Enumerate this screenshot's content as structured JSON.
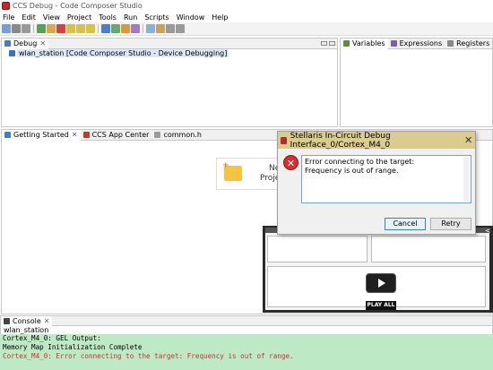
{
  "window": {
    "title": "CCS Debug - Code Composer Studio"
  },
  "menu": [
    "File",
    "Edit",
    "View",
    "Project",
    "Tools",
    "Run",
    "Scripts",
    "Window",
    "Help"
  ],
  "debug_view": {
    "tab_label": "Debug",
    "tree_item": "wlan_station [Code Composer Studio - Device Debugging]"
  },
  "right_views": {
    "tabs": [
      "Variables",
      "Expressions",
      "Registers"
    ]
  },
  "editor": {
    "tabs": [
      "Getting Started",
      "CCS App Center",
      "common.h"
    ],
    "card_partial_1": "Ne",
    "card_partial_2": "Proje"
  },
  "dialog": {
    "title": "Stellaris In-Circuit Debug Interface_0/Cortex_M4_0",
    "message_line1": "Error connecting to the target:",
    "message_line2": "Frequency is out of range.",
    "cancel_label": "Cancel",
    "retry_label": "Retry",
    "close_glyph": "✕",
    "error_glyph": "✕"
  },
  "video": {
    "play_all_label": "PLAY ALL"
  },
  "console": {
    "tab_label": "Console",
    "project": "wlan_station",
    "lines": [
      {
        "text": "Cortex_M4_0: GEL Output:",
        "color": "#000000"
      },
      {
        "text": "Memory Map Initialization Complete",
        "color": "#000000"
      },
      {
        "text": "Cortex_M4_0: Error connecting to the target: Frequency is out of range.",
        "color": "#d32f2f"
      }
    ]
  },
  "colors": {
    "dialog_title_bg": "#d9cc8e",
    "console_bg": "#bde9c5",
    "error": "#d32f2f"
  }
}
